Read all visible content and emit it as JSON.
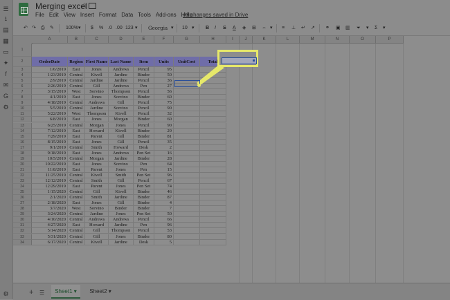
{
  "doc": {
    "title": "Merging excel",
    "saved_status": "All changes saved in Drive",
    "menus": [
      "File",
      "Edit",
      "View",
      "Insert",
      "Format",
      "Data",
      "Tools",
      "Add-ons",
      "Help"
    ]
  },
  "toolbar": {
    "zoom": "100%",
    "currency": "$",
    "percent": "%",
    "dec_less": ".0",
    "dec_more": ".00",
    "more_formats": "123",
    "font": "Georgia",
    "font_size": "10",
    "bold": "B",
    "italic": "I",
    "strike": "S",
    "text_color": "A"
  },
  "grid": {
    "columns": [
      "A",
      "B",
      "C",
      "D",
      "E",
      "F",
      "G",
      "H",
      "I",
      "J",
      "K",
      "L",
      "M",
      "N",
      "O",
      "P"
    ],
    "headers": [
      "OrderDate",
      "Region",
      "First Name",
      "Last Name",
      "Item",
      "Units",
      "UnitCost",
      "Total"
    ],
    "rows": [
      [
        "1/6/2019",
        "East",
        "Jones",
        "Andrews",
        "Pencil",
        "95"
      ],
      [
        "1/23/2019",
        "Central",
        "Kivell",
        "Jardine",
        "Binder",
        "50"
      ],
      [
        "2/9/2019",
        "Central",
        "Jardine",
        "Jardine",
        "Pencil",
        "36"
      ],
      [
        "2/26/2019",
        "Central",
        "Gill",
        "Andrews",
        "Pen",
        "27"
      ],
      [
        "3/15/2019",
        "West",
        "Sorvino",
        "Thompson",
        "Pencil",
        "56"
      ],
      [
        "4/1/2019",
        "East",
        "Jones",
        "Sorvino",
        "Binder",
        "60"
      ],
      [
        "4/18/2019",
        "Central",
        "Andrews",
        "Gill",
        "Pencil",
        "75"
      ],
      [
        "5/5/2019",
        "Central",
        "Jardine",
        "Sorvino",
        "Pencil",
        "90"
      ],
      [
        "5/22/2019",
        "West",
        "Thompson",
        "Kivell",
        "Pencil",
        "32"
      ],
      [
        "6/8/2019",
        "East",
        "Jones",
        "Morgan",
        "Binder",
        "60"
      ],
      [
        "6/25/2019",
        "Central",
        "Morgan",
        "Jones",
        "Pencil",
        "90"
      ],
      [
        "7/12/2019",
        "East",
        "Howard",
        "Kivell",
        "Binder",
        "29"
      ],
      [
        "7/29/2019",
        "East",
        "Parent",
        "Gill",
        "Binder",
        "81"
      ],
      [
        "8/15/2019",
        "East",
        "Jones",
        "Gill",
        "Pencil",
        "35"
      ],
      [
        "9/1/2019",
        "Central",
        "Smith",
        "Howard",
        "Desk",
        "2"
      ],
      [
        "9/18/2019",
        "East",
        "Jones",
        "Andrews",
        "Pen Set",
        "16"
      ],
      [
        "10/5/2019",
        "Central",
        "Morgan",
        "Jardine",
        "Binder",
        "28"
      ],
      [
        "10/22/2019",
        "East",
        "Jones",
        "Sorvino",
        "Pen",
        "64"
      ],
      [
        "11/8/2019",
        "East",
        "Parent",
        "Jones",
        "Pen",
        "15"
      ],
      [
        "11/25/2019",
        "Central",
        "Kivell",
        "Smith",
        "Pen Set",
        "96"
      ],
      [
        "12/12/2019",
        "Central",
        "Smith",
        "Gill",
        "Pencil",
        "67"
      ],
      [
        "12/29/2019",
        "East",
        "Parent",
        "Jones",
        "Pen Set",
        "74"
      ],
      [
        "1/15/2020",
        "Central",
        "Gill",
        "Kivell",
        "Binder",
        "46"
      ],
      [
        "2/1/2020",
        "Central",
        "Smith",
        "Jardine",
        "Binder",
        "87"
      ],
      [
        "2/18/2020",
        "East",
        "Jones",
        "Gill",
        "Binder",
        "4"
      ],
      [
        "3/7/2020",
        "West",
        "Sorvino",
        "Binder",
        "Binder",
        "7"
      ],
      [
        "3/24/2020",
        "Central",
        "Jardine",
        "Jones",
        "Pen Set",
        "50"
      ],
      [
        "4/10/2020",
        "Central",
        "Andrews",
        "Andrews",
        "Pencil",
        "66"
      ],
      [
        "4/27/2020",
        "East",
        "Howard",
        "Jardine",
        "Pen",
        "96"
      ],
      [
        "5/14/2020",
        "Central",
        "Gill",
        "Thompson",
        "Pencil",
        "53"
      ],
      [
        "5/31/2020",
        "Central",
        "Gill",
        "Jones",
        "Binder",
        "80"
      ],
      [
        "6/17/2020",
        "Central",
        "Kivell",
        "Jardine",
        "Desk",
        "5"
      ]
    ]
  },
  "sheets": [
    "Sheet1",
    "Sheet2"
  ],
  "colors": {
    "header_fill": "#6f6da8",
    "callout": "#e6e86a",
    "selection": "#2a4f9a"
  }
}
